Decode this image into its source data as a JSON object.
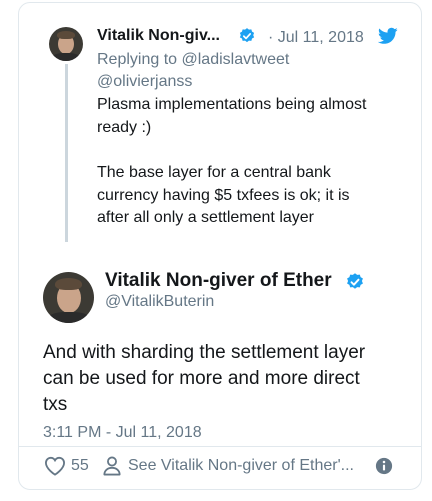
{
  "reply_tweet": {
    "name": "Vitalik Non-giv...",
    "separator_date": "· Jul 11, 2018",
    "replying_line1": "Replying to @ladislavtweet",
    "replying_line2": "@olivierjanss",
    "lines": [
      "Plasma implementations being almost",
      "ready :)",
      "The base layer for a central bank",
      "currency having $5 txfees is ok; it is",
      "after all only a settlement layer"
    ]
  },
  "main_tweet": {
    "name": "Vitalik Non-giver of Ether",
    "handle": "@VitalikButerin",
    "lines": [
      "And with sharding the settlement layer",
      "can be used for more and more direct",
      "txs"
    ],
    "timestamp": "3:11 PM - Jul 11, 2018"
  },
  "footer": {
    "likes": "55",
    "see_more": "See Vitalik Non-giver of Ether'..."
  },
  "colors": {
    "twitter_blue": "#1da1f2",
    "muted": "#657786",
    "heart": "#e0245e"
  },
  "icons": [
    "verified-badge-icon",
    "twitter-bird-icon",
    "heart-icon",
    "person-icon",
    "info-icon"
  ]
}
